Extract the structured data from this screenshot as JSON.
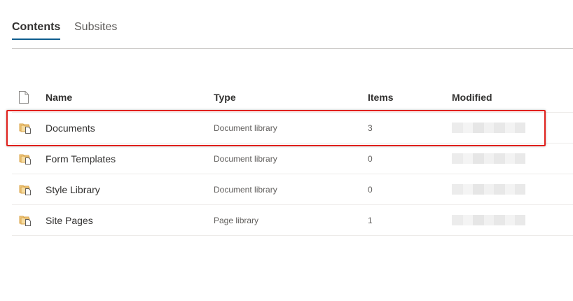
{
  "tabs": [
    {
      "label": "Contents",
      "active": true
    },
    {
      "label": "Subsites",
      "active": false
    }
  ],
  "table": {
    "headers": {
      "icon": "document-icon",
      "name": "Name",
      "type": "Type",
      "items": "Items",
      "modified": "Modified"
    },
    "rows": [
      {
        "icon": "library-icon",
        "name": "Documents",
        "type": "Document library",
        "items": "3",
        "highlighted": true
      },
      {
        "icon": "library-icon",
        "name": "Form Templates",
        "type": "Document library",
        "items": "0",
        "highlighted": false
      },
      {
        "icon": "library-icon",
        "name": "Style Library",
        "type": "Document library",
        "items": "0",
        "highlighted": false
      },
      {
        "icon": "library-icon",
        "name": "Site Pages",
        "type": "Page library",
        "items": "1",
        "highlighted": false
      }
    ]
  },
  "colors": {
    "accent": "#0f5d8f",
    "highlight": "#e0201c",
    "library_icon": "#d9a34a"
  }
}
